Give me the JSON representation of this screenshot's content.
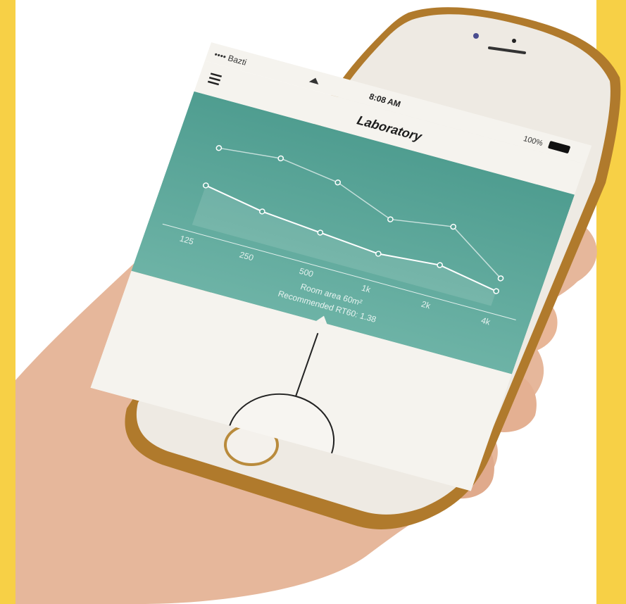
{
  "colors": {
    "background_band": "#f7d046",
    "app_teal": "#5aa597",
    "phone_body": "#eeeae3",
    "phone_frame_gold": "#b07a2c"
  },
  "status_bar": {
    "carrier": "•••• Bazti",
    "wifi_icon": "wifi-icon",
    "time": "8:08 AM",
    "battery": "100%"
  },
  "header": {
    "menu_icon": "hamburger-menu-icon",
    "title": "Laboratory"
  },
  "chart_data": {
    "type": "line",
    "categories": [
      "125",
      "250",
      "500",
      "1k",
      "2k",
      "4k"
    ],
    "series": [
      {
        "values": [
          0.78,
          0.84,
          0.76,
          0.55,
          0.64,
          0.28
        ]
      },
      {
        "values": [
          0.4,
          0.3,
          0.25,
          0.2,
          0.25,
          0.15
        ]
      }
    ],
    "grid": false
  },
  "annotations": {
    "line1": "Room area 60m²",
    "line2": "Recommended RT60: 1.38"
  }
}
